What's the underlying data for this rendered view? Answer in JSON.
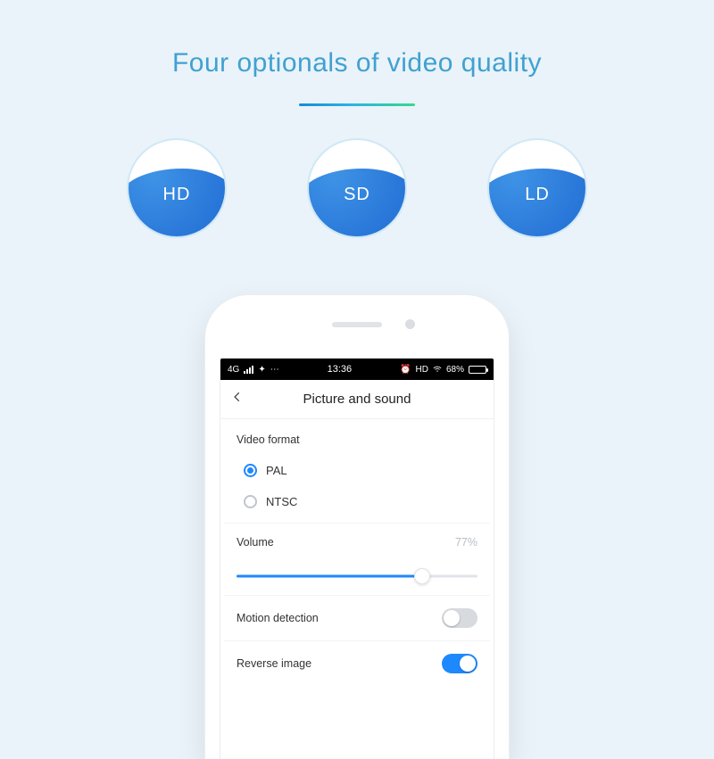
{
  "hero": {
    "title": "Four optionals of  video quality",
    "badges": [
      "HD",
      "SD",
      "LD"
    ]
  },
  "phone": {
    "statusbar": {
      "network": "4G",
      "time": "13:36",
      "hd": "HD",
      "battery_pct": "68%"
    },
    "nav": {
      "title": "Picture and sound"
    },
    "video_format": {
      "label": "Video format",
      "options": [
        {
          "label": "PAL",
          "checked": true
        },
        {
          "label": "NTSC",
          "checked": false
        }
      ]
    },
    "volume": {
      "label": "Volume",
      "value_text": "77%",
      "percent": 77
    },
    "rows": [
      {
        "label": "Motion detection",
        "on": false
      },
      {
        "label": "Reverse image",
        "on": true
      }
    ]
  }
}
